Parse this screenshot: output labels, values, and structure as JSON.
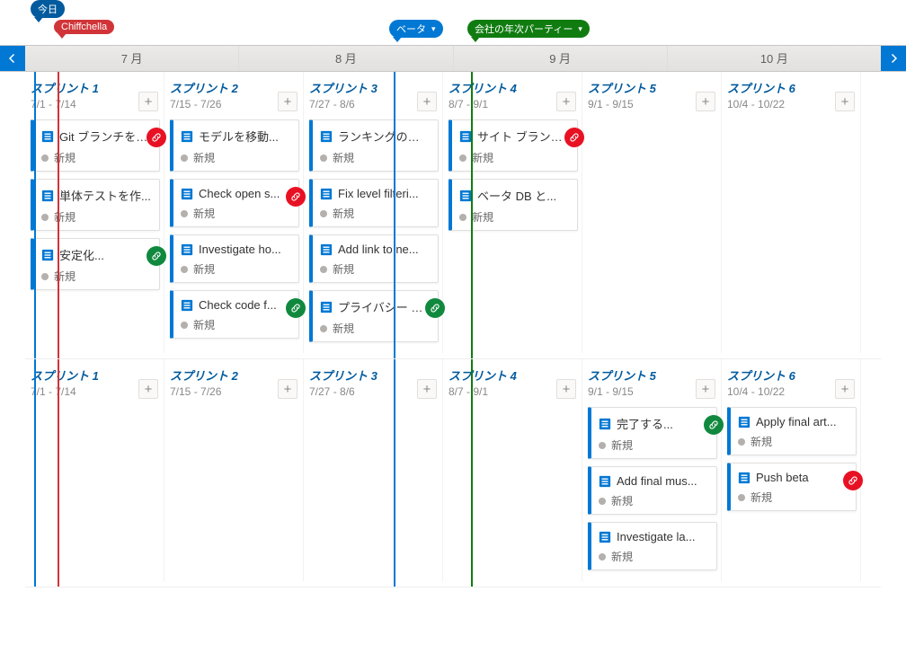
{
  "markers": {
    "today": "今日",
    "red": "Chiffchella",
    "blue": "ベータ",
    "green": "会社の年次パーティー"
  },
  "months": [
    "7 月",
    "8 月",
    "9 月",
    "10 月"
  ],
  "status_new": "新規",
  "lanes": [
    {
      "sprints": [
        {
          "title": "スプリント 1",
          "dates": "7/1 - 7/14",
          "cards": [
            {
              "title": "Git ブランチを作...",
              "link": "red"
            },
            {
              "title": "単体テストを作..."
            },
            {
              "title": "安定化...",
              "link": "green"
            }
          ]
        },
        {
          "title": "スプリント 2",
          "dates": "7/15 - 7/26",
          "cards": [
            {
              "title": "モデルを移動..."
            },
            {
              "title": "Check open s...",
              "link": "red"
            },
            {
              "title": "Investigate ho..."
            },
            {
              "title": "Check code f...",
              "link": "green"
            }
          ]
        },
        {
          "title": "スプリント 3",
          "dates": "7/27 - 8/6",
          "cards": [
            {
              "title": "ランキングの並べ..."
            },
            {
              "title": "Fix level filteri..."
            },
            {
              "title": "Add link to ne..."
            },
            {
              "title": "プライバシー ポリ...",
              "link": "green"
            }
          ]
        },
        {
          "title": "スプリント 4",
          "dates": "8/7 - 9/1",
          "cards": [
            {
              "title": "サイト ブランドを...",
              "link": "red"
            },
            {
              "title": "ベータ DB と..."
            }
          ]
        },
        {
          "title": "スプリント 5",
          "dates": "9/1 - 9/15",
          "cards": []
        },
        {
          "title": "スプリント 6",
          "dates": "10/4 - 10/22",
          "cards": []
        }
      ]
    },
    {
      "sprints": [
        {
          "title": "スプリント 1",
          "dates": "7/1 - 7/14",
          "cards": []
        },
        {
          "title": "スプリント 2",
          "dates": "7/15 - 7/26",
          "cards": []
        },
        {
          "title": "スプリント 3",
          "dates": "7/27 - 8/6",
          "cards": []
        },
        {
          "title": "スプリント 4",
          "dates": "8/7 - 9/1",
          "cards": []
        },
        {
          "title": "スプリント 5",
          "dates": "9/1 - 9/15",
          "cards": [
            {
              "title": "完了する...",
              "link": "green"
            },
            {
              "title": "Add final mus..."
            },
            {
              "title": "Investigate la..."
            }
          ]
        },
        {
          "title": "スプリント 6",
          "dates": "10/4 - 10/22",
          "cards": [
            {
              "title": "Apply final art..."
            },
            {
              "title": "Push beta",
              "link": "red"
            }
          ]
        }
      ]
    }
  ]
}
